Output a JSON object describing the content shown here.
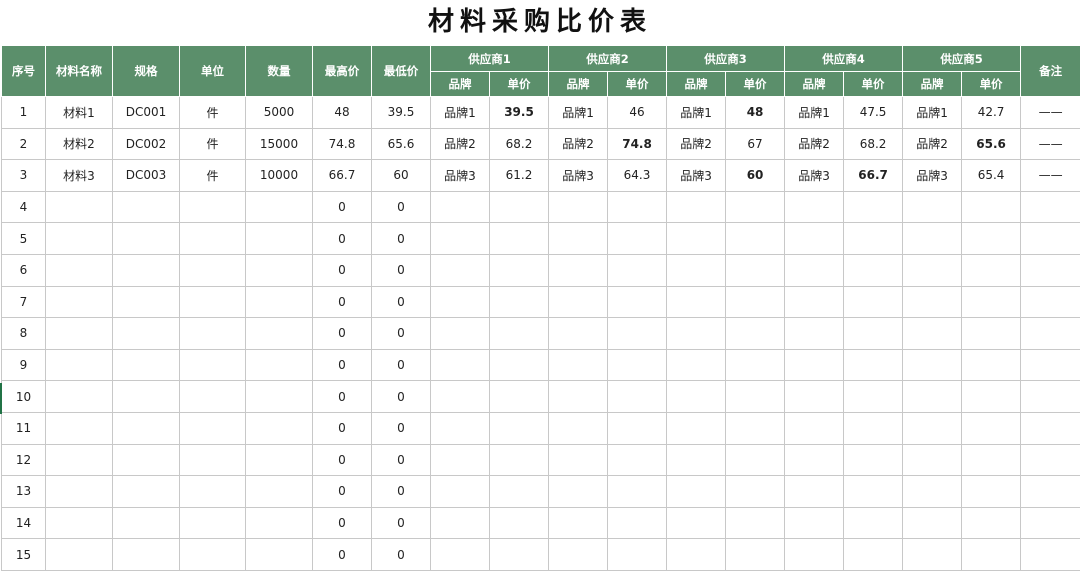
{
  "title": "材料采购比价表",
  "headers": {
    "seq": "序号",
    "name": "材料名称",
    "spec": "规格",
    "unit": "单位",
    "qty": "数量",
    "max": "最高价",
    "min": "最低价",
    "suppliers": [
      "供应商1",
      "供应商2",
      "供应商3",
      "供应商4",
      "供应商5"
    ],
    "brand": "品牌",
    "price": "单价",
    "remark": "备注"
  },
  "colors": {
    "header_bg": "#5b8f6b",
    "high": "#e02020",
    "low": "#1aa34a"
  },
  "rows": [
    {
      "seq": "1",
      "name": "材料1",
      "spec": "DC001",
      "unit": "件",
      "qty": "5000",
      "max": "48",
      "min": "39.5",
      "suppliers": [
        {
          "brand": "品牌1",
          "price": "39.5",
          "mark": "low"
        },
        {
          "brand": "品牌1",
          "price": "46",
          "mark": ""
        },
        {
          "brand": "品牌1",
          "price": "48",
          "mark": "high"
        },
        {
          "brand": "品牌1",
          "price": "47.5",
          "mark": ""
        },
        {
          "brand": "品牌1",
          "price": "42.7",
          "mark": ""
        }
      ],
      "remark": "——"
    },
    {
      "seq": "2",
      "name": "材料2",
      "spec": "DC002",
      "unit": "件",
      "qty": "15000",
      "max": "74.8",
      "min": "65.6",
      "suppliers": [
        {
          "brand": "品牌2",
          "price": "68.2",
          "mark": ""
        },
        {
          "brand": "品牌2",
          "price": "74.8",
          "mark": "high"
        },
        {
          "brand": "品牌2",
          "price": "67",
          "mark": ""
        },
        {
          "brand": "品牌2",
          "price": "68.2",
          "mark": ""
        },
        {
          "brand": "品牌2",
          "price": "65.6",
          "mark": "low"
        }
      ],
      "remark": "——"
    },
    {
      "seq": "3",
      "name": "材料3",
      "spec": "DC003",
      "unit": "件",
      "qty": "10000",
      "max": "66.7",
      "min": "60",
      "suppliers": [
        {
          "brand": "品牌3",
          "price": "61.2",
          "mark": ""
        },
        {
          "brand": "品牌3",
          "price": "64.3",
          "mark": ""
        },
        {
          "brand": "品牌3",
          "price": "60",
          "mark": "low"
        },
        {
          "brand": "品牌3",
          "price": "66.7",
          "mark": "high"
        },
        {
          "brand": "品牌3",
          "price": "65.4",
          "mark": ""
        }
      ],
      "remark": "——"
    },
    {
      "seq": "4",
      "max": "0",
      "min": "0"
    },
    {
      "seq": "5",
      "max": "0",
      "min": "0"
    },
    {
      "seq": "6",
      "max": "0",
      "min": "0"
    },
    {
      "seq": "7",
      "max": "0",
      "min": "0"
    },
    {
      "seq": "8",
      "max": "0",
      "min": "0"
    },
    {
      "seq": "9",
      "max": "0",
      "min": "0"
    },
    {
      "seq": "10",
      "max": "0",
      "min": "0"
    },
    {
      "seq": "11",
      "max": "0",
      "min": "0"
    },
    {
      "seq": "12",
      "max": "0",
      "min": "0"
    },
    {
      "seq": "13",
      "max": "0",
      "min": "0"
    },
    {
      "seq": "14",
      "max": "0",
      "min": "0"
    },
    {
      "seq": "15",
      "max": "0",
      "min": "0"
    }
  ]
}
